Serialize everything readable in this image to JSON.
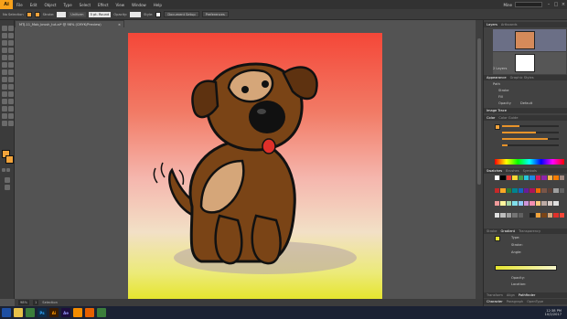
{
  "app": {
    "logo": "Ai"
  },
  "menu": [
    "File",
    "Edit",
    "Object",
    "Type",
    "Select",
    "Effect",
    "View",
    "Window",
    "Help"
  ],
  "workspace": {
    "label": "Mine"
  },
  "control_bar": {
    "selection": "No Selection",
    "stroke_label": "Stroke:",
    "brush_profile": "Uniform",
    "brush": "5 pt. Round",
    "opacity_label": "Opacity:",
    "style_label": "Style:",
    "doc_setup_button": "Document Setup",
    "preferences_button": "Preferences"
  },
  "document_tab": {
    "title": "MTJ-11_Mob_brush_tut.ai* @ 98% (CMYK/Preview)",
    "close": "×"
  },
  "status_bar": {
    "zoom": "98%",
    "page": "1",
    "tool": "Selection"
  },
  "panels": {
    "layers": {
      "tabs": [
        "Layers",
        "Artboards"
      ],
      "count": "2 Layers"
    },
    "appearance": {
      "tabs": [
        "Appearance",
        "Graphic Styles"
      ],
      "path_label": "Path",
      "stroke_label": "Stroke",
      "fill_label": "Fill",
      "opacity_label": "Opacity",
      "opacity_value": "Default"
    },
    "image_trace": {
      "title": "Image Trace"
    },
    "color": {
      "tabs": [
        "Color",
        "Color Guide"
      ]
    },
    "swatches": {
      "tabs": [
        "Swatches",
        "Brushes",
        "Symbols"
      ]
    },
    "gradient": {
      "tabs": [
        "Stroke",
        "Gradient",
        "Transparency"
      ],
      "type_label": "Type:",
      "stroke_label": "Stroke:",
      "angle_label": "Angle:",
      "opacity_label": "Opacity:",
      "location_label": "Location:"
    },
    "bottom_tabs": [
      "Transform",
      "Align",
      "Pathfinder"
    ],
    "bottom_tabs2": [
      "Character",
      "Paragraph",
      "OpenType"
    ]
  },
  "taskbar": {
    "apps": [
      "IE",
      "Folder",
      "Chrome",
      "Ps",
      "Ai",
      "Ae",
      "VLC",
      "Firefox",
      "Chrome"
    ],
    "time": "12:38 PM",
    "date": "10/2/2017"
  },
  "colors": {
    "accent": "#f7a11a",
    "fill_swatch": "#f2a33a",
    "gradient_top": "#f44738",
    "gradient_bottom": "#e6e52e"
  }
}
